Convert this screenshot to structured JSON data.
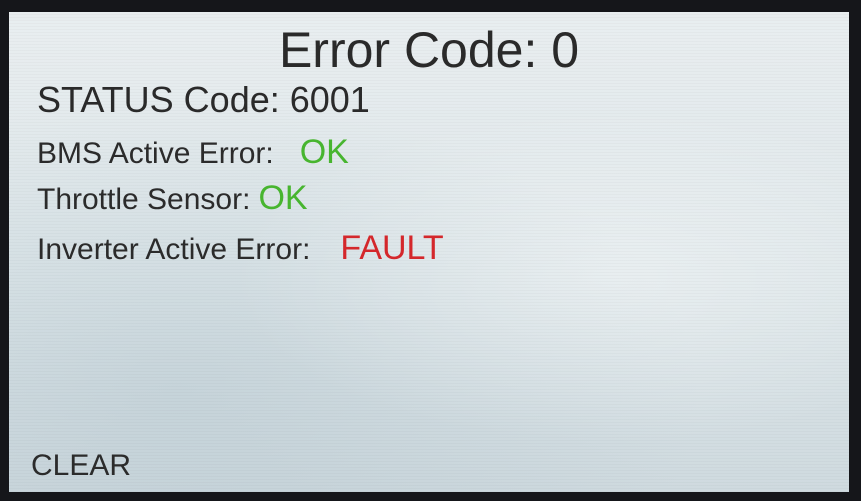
{
  "header": {
    "title": "Error Code: 0",
    "status": "STATUS Code: 6001"
  },
  "rows": [
    {
      "label": "BMS Active Error:",
      "value": "OK",
      "color": "#47b52f"
    },
    {
      "label": "Throttle Sensor:",
      "value": "OK",
      "color": "#47b52f"
    },
    {
      "label": "Inverter Active Error:",
      "value": "FAULT",
      "color": "#d4272b"
    }
  ],
  "actions": {
    "clear_label": "CLEAR"
  }
}
